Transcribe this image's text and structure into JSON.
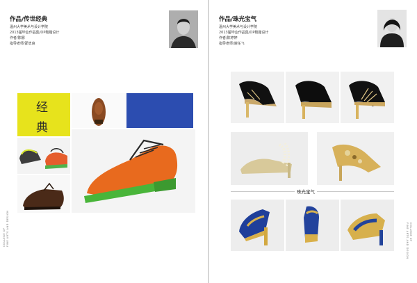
{
  "left_page": {
    "title": "作品/传世经典",
    "info": [
      "温州大学美术与设计学院",
      "2013届毕业作品集/OP鞋履设计",
      "作者/陈娜",
      "指导老师/邵忠良"
    ],
    "banner_chars": [
      "经",
      "典"
    ],
    "spine_text": [
      "COLLEGE OF",
      "FINE ARTS AND DESIGN"
    ]
  },
  "right_page": {
    "title": "作品/珠光宝气",
    "info": [
      "温州大学美术与设计学院",
      "2013届毕业作品集/OP鞋履设计",
      "作者/陈婷婷",
      "指导老师/谢任飞"
    ],
    "section_label": "珠光宝气",
    "spine_text": [
      "COLLEGE OF",
      "FINE ARTS AND DESIGN"
    ]
  },
  "colors": {
    "yellow_block": "#e7e31c",
    "blue_block": "#2c4db0",
    "orange_shoe": "#e86a1e",
    "green_sole": "#49b53a"
  }
}
